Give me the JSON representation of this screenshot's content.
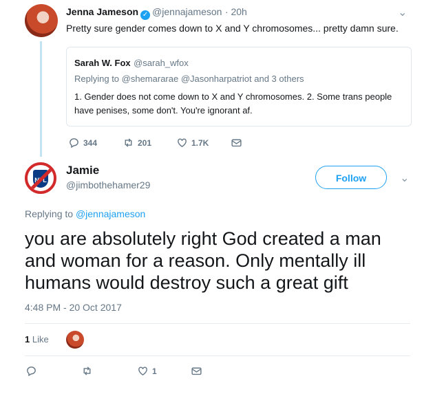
{
  "quoted_tweet": {
    "author_name": "Jenna Jameson",
    "author_handle": "@jennajameson",
    "time": "· 20h",
    "text": "Pretty sure gender comes down to X and Y chromosomes... pretty damn sure.",
    "inner_quote": {
      "author_name": "Sarah W. Fox",
      "author_handle": "@sarah_wfox",
      "replying_to": "Replying to @shemararae @Jasonharpatriot and 3 others",
      "text": "1. Gender does not come down to X and Y chromosomes. 2. Some trans people have penises, some don't. You're ignorant af."
    },
    "actions": {
      "replies": "344",
      "retweets": "201",
      "likes": "1.7K"
    }
  },
  "main_tweet": {
    "author_name": "Jamie",
    "author_handle": "@jimbothehamer29",
    "follow_label": "Follow",
    "replying_to_prefix": "Replying to ",
    "replying_to_handle": "@jennajameson",
    "text": "you are absolutely right God created a man and woman for a reason.  Only mentally ill humans would destroy such a great gift",
    "timestamp": "4:48 PM - 20 Oct 2017",
    "likes_count": "1",
    "likes_label": "Like",
    "like_action_count": "1"
  },
  "colors": {
    "accent": "#1da1f2",
    "muted": "#657786",
    "thread_line": "#c4e3f2"
  },
  "icons": [
    "reply-icon",
    "retweet-icon",
    "heart-icon",
    "mail-icon",
    "chevron-down-icon",
    "verified-icon"
  ]
}
